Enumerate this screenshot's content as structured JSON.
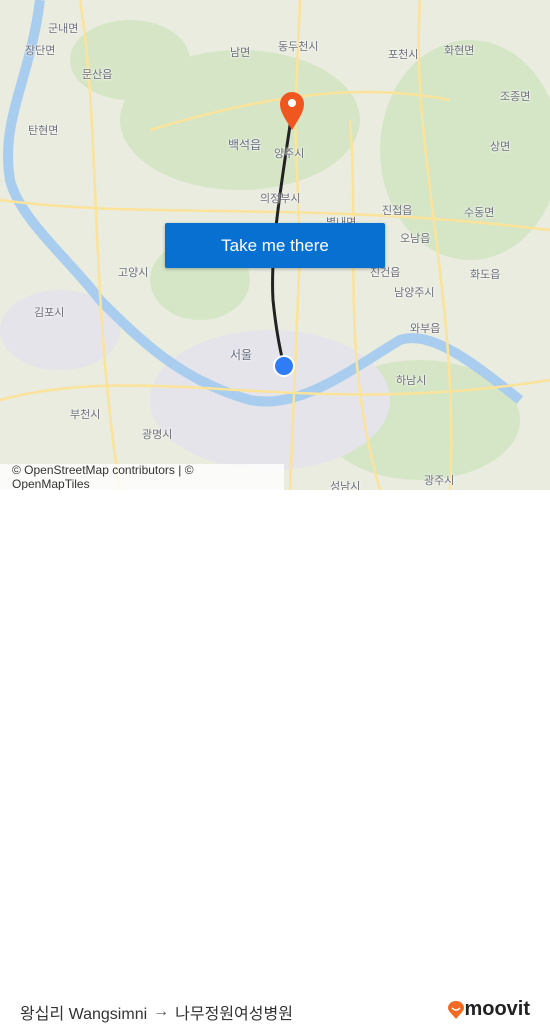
{
  "map": {
    "labels": [
      "군내면",
      "장단면",
      "문산읍",
      "탄현면",
      "남면",
      "동두천시",
      "포천시",
      "화현면",
      "조종면",
      "백석읍",
      "양주시",
      "의정부시",
      "진접읍",
      "수동면",
      "별내면",
      "오남읍",
      "고양시",
      "진건읍",
      "화도읍",
      "김포시",
      "남양주시",
      "와부읍",
      "서울",
      "하남시",
      "부천시",
      "광명시",
      "광주시",
      "성남시",
      "상면"
    ],
    "attribution": "© OpenStreetMap contributors | © OpenMapTiles",
    "origin_color": "#2f7cf6",
    "destination_color": "#f0561f",
    "route_color": "#222222"
  },
  "cta": {
    "label": "Take me there",
    "color": "#0870d0"
  },
  "footer": {
    "origin": "왕십리 Wangsimni",
    "arrow": "→",
    "destination": "나무정원여성병원",
    "brand": "moovit",
    "brand_color": "#f26b22"
  }
}
